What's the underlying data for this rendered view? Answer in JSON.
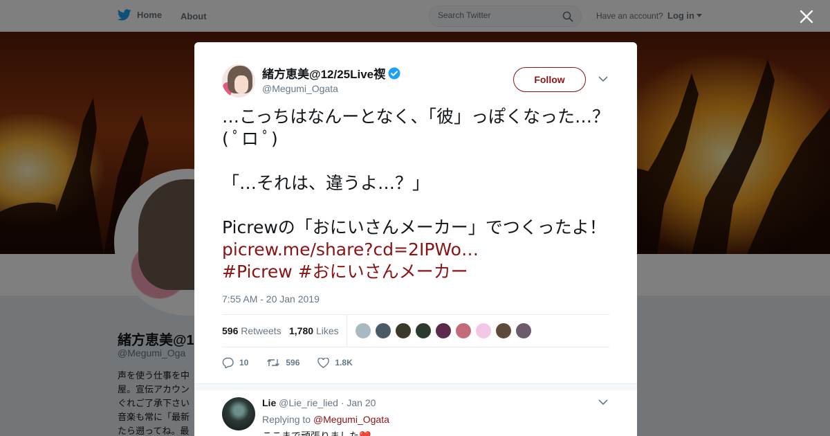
{
  "topbar": {
    "home_label": "Home",
    "about_label": "About",
    "search_placeholder": "Search Twitter",
    "have_account": "Have an account?",
    "login_label": "Log in"
  },
  "profile": {
    "name": "緒方恵美@1",
    "handle": "@Megumi_Oga",
    "bio_lines": [
      "声を使う仕事を中",
      "屋。宣伝アカウン",
      "ぐれご了承下さい",
      "音楽も常に「最新",
      "たら遡ってね。最"
    ]
  },
  "tweet": {
    "author_name": "緒方恵美@12/25Live禊",
    "author_handle": "@Megumi_Ogata",
    "follow_label": "Follow",
    "lines": [
      "…こっちはなんーとなく、「彼」っぽくなった…？( ﾟロ ﾟ)",
      "「…それは、違うよ…？」",
      "Picrewの「おにいさんメーカー」でつくったよ！ "
    ],
    "link": "picrew.me/share?cd=2IPWo…",
    "hashtags": [
      "#Picrew",
      "#おにいさんメーカー"
    ],
    "timestamp": "7:55 AM - 20 Jan 2019",
    "retweets_count": "596",
    "retweets_label": "Retweets",
    "likes_count": "1,780",
    "likes_label": "Likes",
    "liker_colors": [
      "#aab8c2",
      "#4a5a66",
      "#3b3a2a",
      "#2d3b2f",
      "#5c2a4a",
      "#c46b7a",
      "#f3c6e8",
      "#5d4a3a",
      "#6b5b6b"
    ],
    "reply_count": "10",
    "retweet_count_short": "596",
    "like_count_short": "1.8K"
  },
  "reply": {
    "name": "Lie",
    "handle": "@Lie_rie_lied",
    "date": "· Jan 20",
    "replying_to_label": "Replying to",
    "replying_to_handle": "@Megumi_Ogata",
    "text": "ここまで頑張りました❤️"
  },
  "colors": {
    "brand_twitter": "#1da1f2",
    "accent": "#8b1213",
    "verified": "#1da1f2"
  }
}
